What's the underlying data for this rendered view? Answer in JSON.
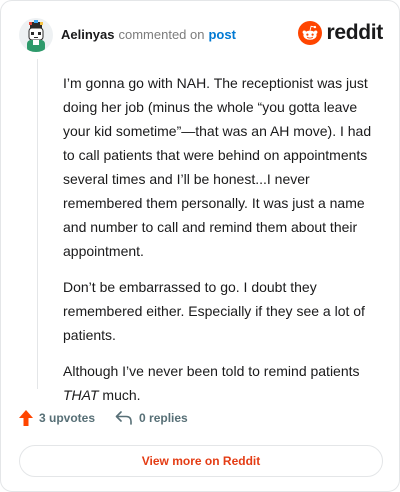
{
  "comment": {
    "author": "Aelinyas",
    "action_text": "commented on",
    "post_link": "post",
    "paragraphs": [
      "I’m gonna go with NAH. The receptionist was just doing her job (minus the whole “you gotta leave your kid sometime”—that was an AH move). I had to call patients that were behind on appointments several times and I’ll be honest...I never remembered them personally. It was just a name and number to call and remind them about their appointment.",
      "Don’t be embarrassed to go. I doubt they remembered either. Especially if they see a lot of patients."
    ],
    "last_paragraph": {
      "before": "Although I’ve never been told to remind patients ",
      "emphasis": "THAT",
      "after": " much."
    }
  },
  "brand": {
    "name": "reddit",
    "icon": "reddit-logo-icon",
    "color": "#ff4500"
  },
  "stats": {
    "upvotes": "3 upvotes",
    "replies": "0 replies",
    "upvote_icon": "upvote-arrow-icon",
    "reply_icon": "reply-arrow-icon",
    "upvote_color": "#ff4500"
  },
  "footer": {
    "view_more_label": "View more on Reddit"
  }
}
